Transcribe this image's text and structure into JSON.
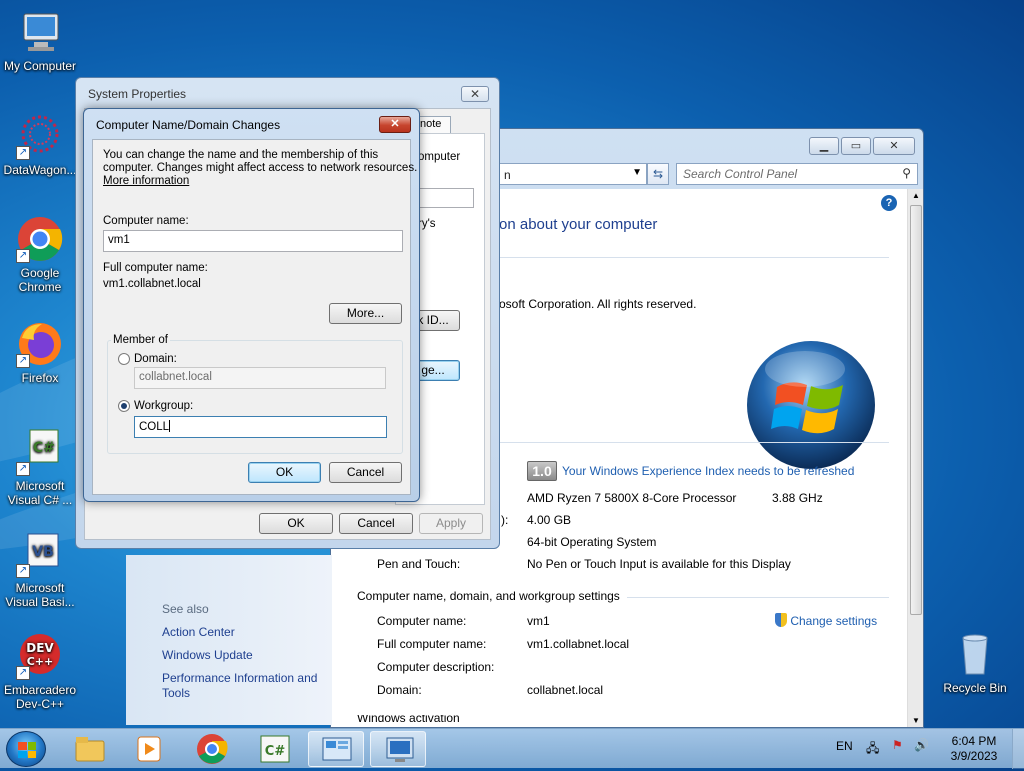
{
  "desktop": {
    "icons": [
      {
        "label": "My Computer"
      },
      {
        "label": "DataWagon..."
      },
      {
        "label": "Google Chrome"
      },
      {
        "label": "Firefox"
      },
      {
        "label": "Microsoft Visual C# ..."
      },
      {
        "label": "Microsoft Visual Basi..."
      },
      {
        "label": "Embarcadero Dev-C++"
      },
      {
        "label": "Recycle Bin"
      }
    ]
  },
  "control_panel": {
    "address_text": "n",
    "search_placeholder": "Search Control Panel",
    "heading": "on about your computer",
    "copyright": "osoft Corporation.  All rights reserved.",
    "wei_score": "1.0",
    "wei_link": "Your Windows Experience Index needs to be refreshed",
    "processor": "AMD Ryzen 7 5800X 8-Core Processor",
    "processor_speed": "3.88 GHz",
    "ram_label_fragment": "):",
    "ram": "4.00 GB",
    "system_type": "64-bit Operating System",
    "pen_touch_label": "Pen and Touch:",
    "pen_touch_value": "No Pen or Touch Input is available for this Display",
    "section_header": "Computer name, domain, and workgroup settings",
    "computer_name_label": "Computer name:",
    "computer_name_value": "vm1",
    "full_name_label": "Full computer name:",
    "full_name_value": "vm1.collabnet.local",
    "description_label": "Computer description:",
    "domain_label": "Domain:",
    "domain_value": "collabnet.local",
    "change_settings": "Change settings",
    "cut_off_text": "Windows activation",
    "see_also": {
      "title": "See also",
      "items": [
        "Action Center",
        "Windows Update",
        "Performance Information and Tools"
      ]
    }
  },
  "system_properties": {
    "title": "System Properties",
    "tab_fragment": "note",
    "frag1": "omputer",
    "frag2": "ry's",
    "frag_btn1": "k ID...",
    "frag_btn2": "ge...",
    "ok": "OK",
    "cancel": "Cancel",
    "apply": "Apply"
  },
  "dialog": {
    "title": "Computer Name/Domain Changes",
    "intro_line1": "You can change the name and the membership of this",
    "intro_line2": "computer. Changes might affect access to network resources.",
    "more_info": "More information",
    "computer_name_label": "Computer name:",
    "computer_name_value": "vm1",
    "full_name_label": "Full computer name:",
    "full_name_value": "vm1.collabnet.local",
    "more_button": "More...",
    "member_of": "Member of",
    "domain_label": "Domain:",
    "domain_value": "collabnet.local",
    "workgroup_label": "Workgroup:",
    "workgroup_value": "COLL",
    "ok": "OK",
    "cancel": "Cancel"
  },
  "taskbar": {
    "language": "EN",
    "time": "6:04 PM",
    "date": "3/9/2023"
  }
}
